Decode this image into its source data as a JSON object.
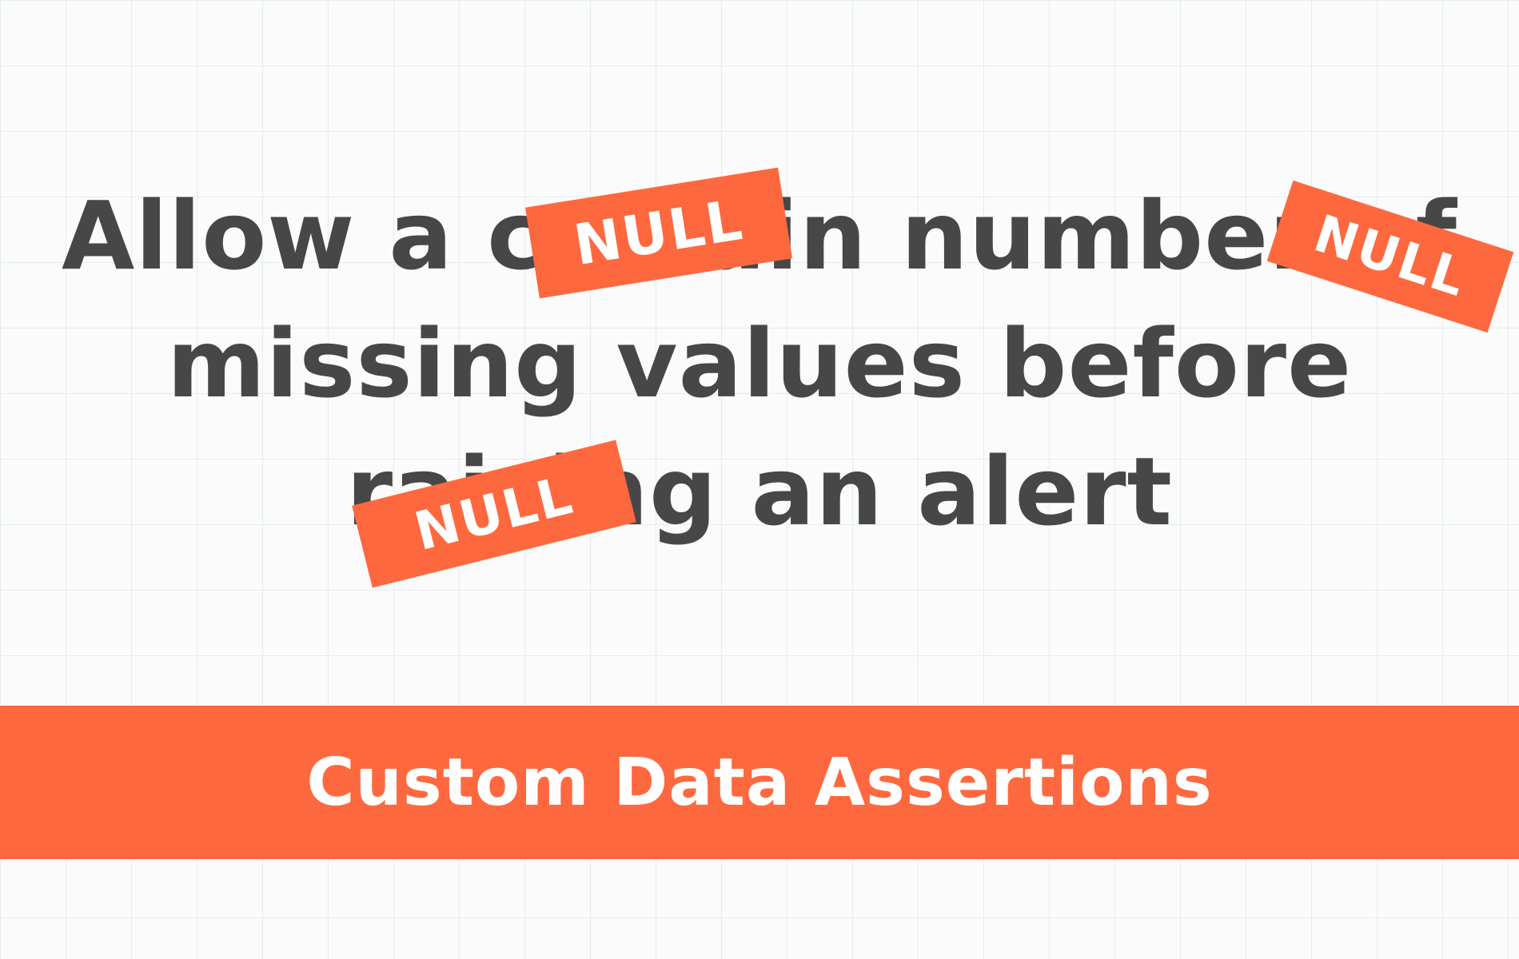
{
  "headline": {
    "line_1": "Allow a certain number of",
    "line_2": "missing values  before",
    "line_3": "raising an alert"
  },
  "stickers": [
    {
      "label": "NULL"
    },
    {
      "label": "NULL"
    },
    {
      "label": "NULL"
    }
  ],
  "banner": {
    "title": "Custom Data Assertions"
  },
  "colors": {
    "accent": "#fe683e",
    "headline_text": "#474747",
    "background": "#fbfbfb",
    "grid": "#e4edf1"
  }
}
